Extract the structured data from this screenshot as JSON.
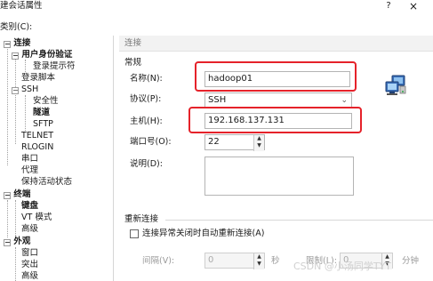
{
  "window": {
    "title": "建会话属性",
    "help_label": "?",
    "close_label": "×"
  },
  "category_label": "类别(C):",
  "tree": {
    "items": [
      {
        "label": "连接",
        "bold": true,
        "toggle": "−"
      },
      {
        "label": "用户身份验证",
        "bold": true,
        "toggle": "−"
      },
      {
        "label": "登录提示符",
        "bold": false
      },
      {
        "label": "登录脚本",
        "bold": false
      },
      {
        "label": "SSH",
        "bold": false,
        "toggle": "−"
      },
      {
        "label": "安全性",
        "bold": false
      },
      {
        "label": "隧道",
        "bold": true
      },
      {
        "label": "SFTP",
        "bold": false
      },
      {
        "label": "TELNET",
        "bold": false
      },
      {
        "label": "RLOGIN",
        "bold": false
      },
      {
        "label": "串口",
        "bold": false
      },
      {
        "label": "代理",
        "bold": false
      },
      {
        "label": "保持活动状态",
        "bold": false
      },
      {
        "label": "终端",
        "bold": true,
        "toggle": "−"
      },
      {
        "label": "键盘",
        "bold": true
      },
      {
        "label": "VT 模式",
        "bold": false
      },
      {
        "label": "高级",
        "bold": false
      },
      {
        "label": "外观",
        "bold": true,
        "toggle": "−"
      },
      {
        "label": "窗口",
        "bold": false
      },
      {
        "label": "突出",
        "bold": false
      },
      {
        "label": "高级",
        "bold": false
      }
    ]
  },
  "header": {
    "title": "连接"
  },
  "general": {
    "section_label": "常规",
    "name_label": "名称(N):",
    "name_value": "hadoop01",
    "protocol_label": "协议(P):",
    "protocol_value": "SSH",
    "host_label": "主机(H):",
    "host_value": "192.168.137.131",
    "port_label": "端口号(O):",
    "port_value": "22",
    "description_label": "说明(D):",
    "description_value": ""
  },
  "reconnect": {
    "section_label": "重新连接",
    "checkbox_label": "连接异常关闭时自动重新连接(A)",
    "checked": false,
    "interval_label": "间隔(V):",
    "interval_value": "0",
    "interval_unit": "秒",
    "limit_label": "限制(L):",
    "limit_value": "0",
    "limit_unit": "分钟"
  },
  "watermark": "CSDN @小汤同学TYT",
  "colors": {
    "highlight": "#e5222a",
    "header_bg": "#f2f2f2"
  }
}
